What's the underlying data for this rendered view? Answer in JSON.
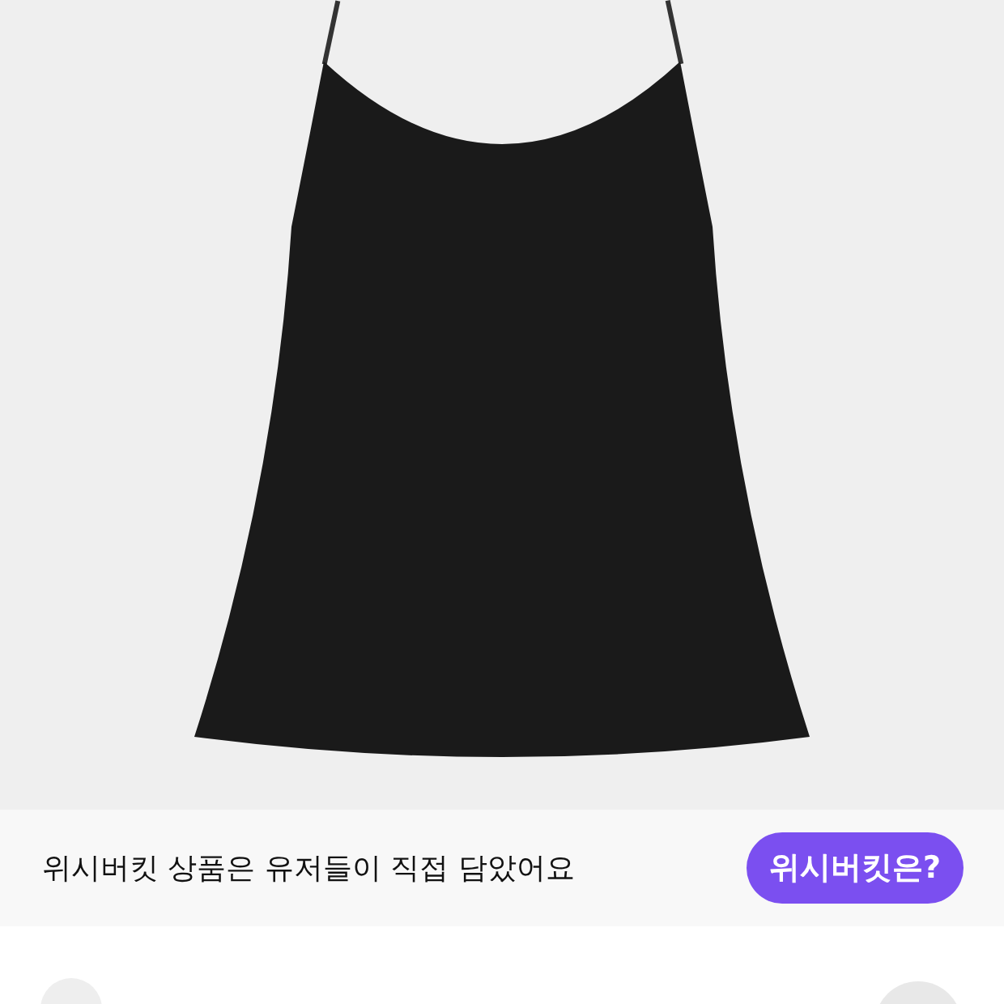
{
  "notice": {
    "text": "위시버킷 상품은 유저들이 직접 담았어요",
    "button": "위시버킷은?"
  }
}
